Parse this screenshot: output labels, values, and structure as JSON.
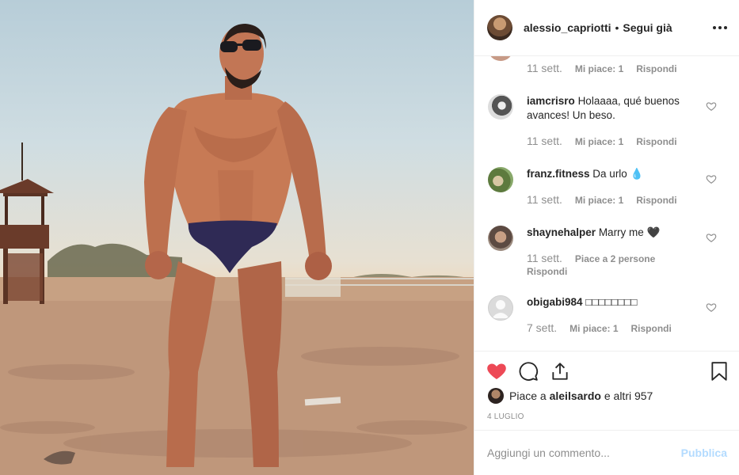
{
  "post": {
    "username": "alessio_capriotti",
    "separator": "•",
    "follow_status": "Segui già",
    "photo_alt": "foto della spiaggia"
  },
  "comments_top_partial": {
    "time": "11 sett.",
    "likes": "Mi piace: 1",
    "reply": "Rispondi"
  },
  "comments": [
    {
      "user": "iamcrisro",
      "text": "Holaaaa, qué buenos avances! Un beso.",
      "time": "11 sett.",
      "likes": "Mi piace: 1",
      "reply": "Rispondi"
    },
    {
      "user": "franz.fitness",
      "text": "Da urlo 💧",
      "time": "11 sett.",
      "likes": "Mi piace: 1",
      "reply": "Rispondi"
    },
    {
      "user": "shaynehalper",
      "text": "Marry me 🖤",
      "time": "11 sett.",
      "likes": "Piace a 2 persone",
      "reply": "Rispondi"
    },
    {
      "user": "obigabi984",
      "text": "□□□□□□□□",
      "time": "7 sett.",
      "likes": "Mi piace: 1",
      "reply": "Rispondi"
    }
  ],
  "liked_by": {
    "prefix": "Piace a",
    "user": "aleilsardo",
    "suffix": "e altri 957"
  },
  "date": "4 LUGLIO",
  "add_comment": {
    "placeholder": "Aggiungi un commento...",
    "publish_label": "Pubblica"
  },
  "colors": {
    "like_red": "#ed4956",
    "text_dark": "#262626",
    "text_muted": "#8e8e8e",
    "publish_disabled": "#b3dbff",
    "border": "#efefef"
  },
  "icons": {
    "like": "heart-filled-icon",
    "comment": "comment-bubble-icon",
    "share": "share-icon",
    "save": "bookmark-icon",
    "more": "more-options-icon",
    "comment_like": "heart-outline-icon"
  }
}
